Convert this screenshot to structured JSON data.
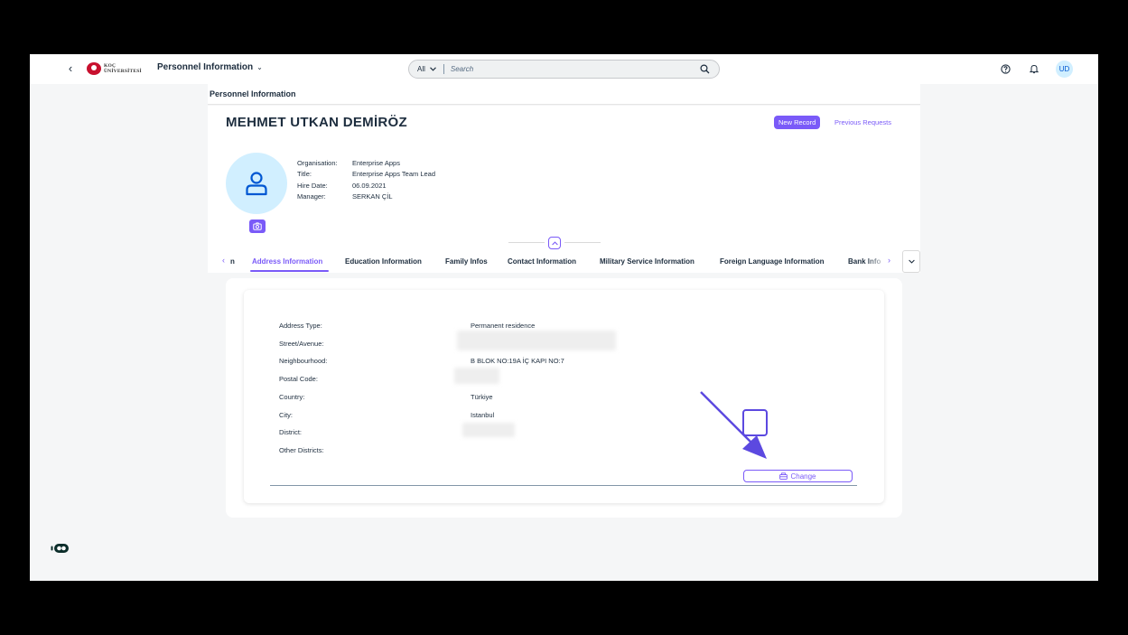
{
  "shell": {
    "logo_line1": "KOÇ",
    "logo_line2": "ÜNİVERSİTESİ",
    "app_title": "Personnel Information",
    "search_scope": "All",
    "search_placeholder": "Search",
    "avatar_initials": "UD"
  },
  "breadcrumb": "Personnel Information",
  "employee": {
    "name": "MEHMET UTKAN DEMİRÖZ",
    "fields": [
      {
        "label": "Organisation:",
        "value": "Enterprise Apps"
      },
      {
        "label": "Title:",
        "value": "Enterprise Apps Team Lead"
      },
      {
        "label": "Hire Date:",
        "value": "06.09.2021"
      },
      {
        "label": "Manager:",
        "value": "SERKAN ÇİL"
      }
    ]
  },
  "header_actions": {
    "new_record": "New Record",
    "previous_requests": "Previous Requests"
  },
  "tabs": [
    {
      "label": "n",
      "active": false
    },
    {
      "label": "Address Information",
      "active": true
    },
    {
      "label": "Education Information",
      "active": false
    },
    {
      "label": "Family Infos",
      "active": false
    },
    {
      "label": "Contact Information",
      "active": false
    },
    {
      "label": "Military Service Information",
      "active": false
    },
    {
      "label": "Foreign Language Information",
      "active": false
    },
    {
      "label": "Bank Info",
      "active": false
    }
  ],
  "address": {
    "rows": [
      {
        "label": "Address Type:",
        "value": "Permanent residence"
      },
      {
        "label": "Street/Avenue:",
        "value": ""
      },
      {
        "label": "Neighbourhood:",
        "value": "B BLOK NO:19A İÇ KAPI NO:7"
      },
      {
        "label": "Postal Code:",
        "value": ""
      },
      {
        "label": "Country:",
        "value": "Türkiye"
      },
      {
        "label": "City:",
        "value": "Istanbul"
      },
      {
        "label": "District:",
        "value": ""
      },
      {
        "label": "Other Districts:",
        "value": ""
      }
    ],
    "change_label": "Change"
  },
  "colors": {
    "accent": "#7a5af8",
    "annotation": "#5c49e0"
  }
}
